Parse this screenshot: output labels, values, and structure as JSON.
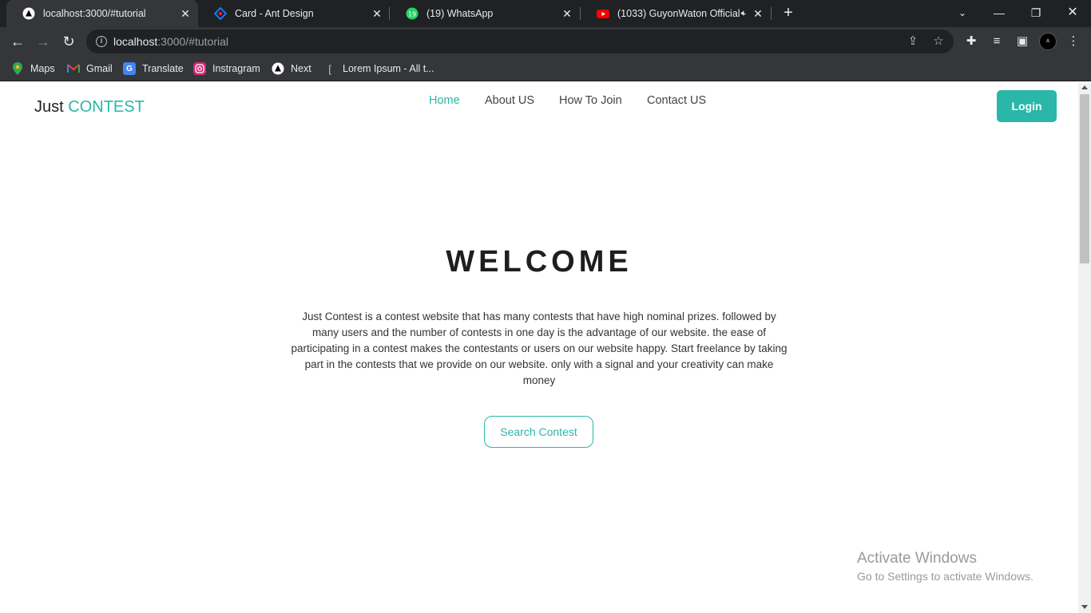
{
  "browser": {
    "tabs": [
      {
        "title": "localhost:3000/#tutorial",
        "icon": "nextjs-icon",
        "active": true
      },
      {
        "title": "Card - Ant Design",
        "icon": "ant-design-icon",
        "active": false
      },
      {
        "title": "(19) WhatsApp",
        "icon": "whatsapp-icon",
        "badge": "19",
        "active": false
      },
      {
        "title": "(1033) GuyonWaton Official -",
        "icon": "youtube-icon",
        "active": false
      }
    ],
    "new_tab": "+",
    "url_host": "localhost",
    "url_rest": ":3000/#tutorial",
    "profile_initial": "A",
    "bookmarks": [
      {
        "label": "Maps",
        "icon": "maps-icon"
      },
      {
        "label": "Gmail",
        "icon": "gmail-icon"
      },
      {
        "label": "Translate",
        "icon": "translate-icon"
      },
      {
        "label": "Instragram",
        "icon": "instagram-icon"
      },
      {
        "label": "Next",
        "icon": "nextjs-icon"
      },
      {
        "label": "Lorem Ipsum - All t...",
        "icon": "lorem-ipsum-icon"
      }
    ]
  },
  "site": {
    "logo_main": "Just ",
    "logo_accent": "CONTEST",
    "nav": [
      {
        "label": "Home",
        "active": true
      },
      {
        "label": "About US",
        "active": false
      },
      {
        "label": "How To Join",
        "active": false
      },
      {
        "label": "Contact US",
        "active": false
      }
    ],
    "login_label": "Login",
    "hero_title": "WELCOME",
    "hero_text": "Just Contest is a contest website that has many contests that have high nominal prizes. followed by many users and the number of contests in one day is the advantage of our website. the ease of participating in a contest makes the contestants or users on our website happy. Start freelance by taking part in the contests that we provide on our website. only with a signal and your creativity can make money",
    "search_label": "Search Contest",
    "accent_color": "#2ab7a9"
  },
  "os_overlay": {
    "line1": "Activate Windows",
    "line2": "Go to Settings to activate Windows."
  }
}
